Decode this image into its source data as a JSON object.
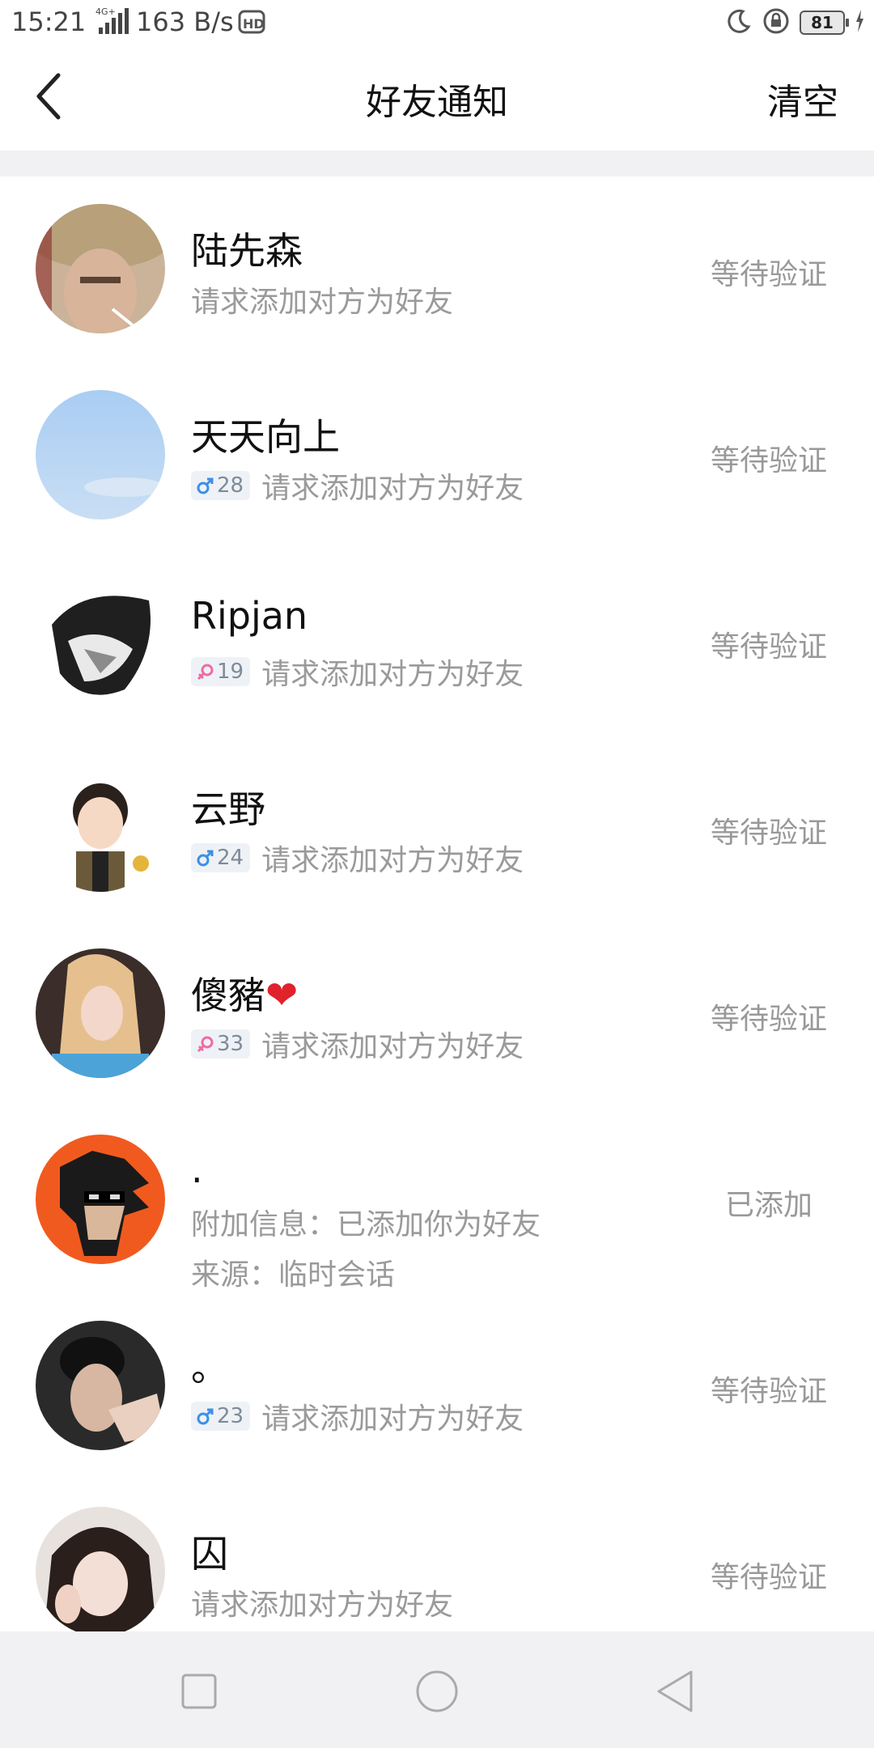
{
  "status_bar": {
    "time": "15:21",
    "net_label": "4G+",
    "speed": "163 B/s",
    "hd": "HD",
    "battery": "81"
  },
  "header": {
    "title": "好友通知",
    "clear_label": "清空"
  },
  "colors": {
    "male_tag": "#3d8fe6",
    "female_tag": "#f06aa6",
    "pending_status": "#999999",
    "separator": "#f1f1f4"
  },
  "requests": [
    {
      "name": "陆先森",
      "gender": null,
      "age": null,
      "message": "请求添加对方为好友",
      "status": "等待验证"
    },
    {
      "name": "天天向上",
      "gender": "male",
      "age": "28",
      "message": "请求添加对方为好友",
      "status": "等待验证"
    },
    {
      "name": "Ripjan",
      "gender": "female",
      "age": "19",
      "message": "请求添加对方为好友",
      "status": "等待验证"
    },
    {
      "name": "云野",
      "gender": "male",
      "age": "24",
      "message": "请求添加对方为好友",
      "status": "等待验证"
    },
    {
      "name": "傻豬",
      "name_suffix": "❤",
      "gender": "female",
      "age": "33",
      "message": "请求添加对方为好友",
      "status": "等待验证"
    },
    {
      "name": ".",
      "gender": null,
      "age": null,
      "message": "附加信息：已添加你为好友",
      "source": "来源：临时会话",
      "status": "已添加"
    },
    {
      "name": "。",
      "gender": "male",
      "age": "23",
      "message": "请求添加对方为好友",
      "status": "等待验证"
    },
    {
      "name": "囚",
      "gender": null,
      "age": null,
      "message": "请求添加对方为好友",
      "status": "等待验证"
    }
  ],
  "bottom_nav": {
    "items": [
      "recent-apps-square-icon",
      "home-circle-icon",
      "back-triangle-icon"
    ]
  }
}
